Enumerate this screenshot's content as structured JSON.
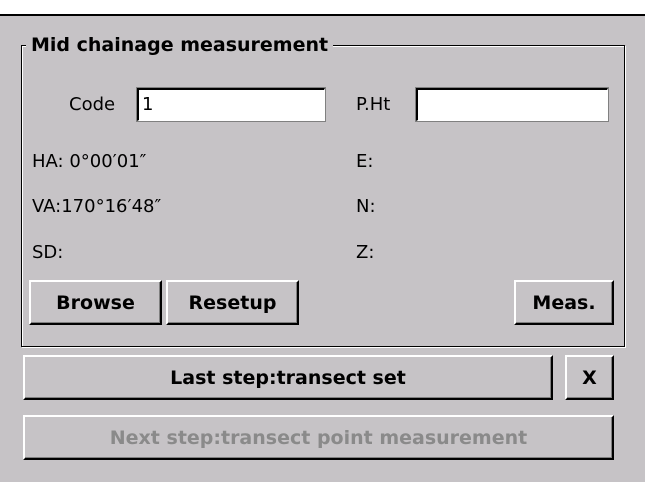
{
  "group": {
    "title": "Mid chainage measurement"
  },
  "fields": {
    "code_label": "Code",
    "code_value": "1",
    "pht_label": "P.Ht",
    "pht_value": ""
  },
  "readouts": {
    "ha": "HA:  0°00′01″",
    "va": "VA:170°16′48″",
    "sd": "SD:",
    "e": "E:",
    "n": "N:",
    "z": "Z:"
  },
  "buttons": {
    "browse": "Browse",
    "resetup": "Resetup",
    "meas": "Meas.",
    "last_step": "Last step:transect set",
    "close": "X",
    "next_step": "Next step:transect point measurement"
  },
  "colors": {
    "dialog_bg": "#c6c3c6",
    "disabled_text": "#8a8a8a"
  }
}
